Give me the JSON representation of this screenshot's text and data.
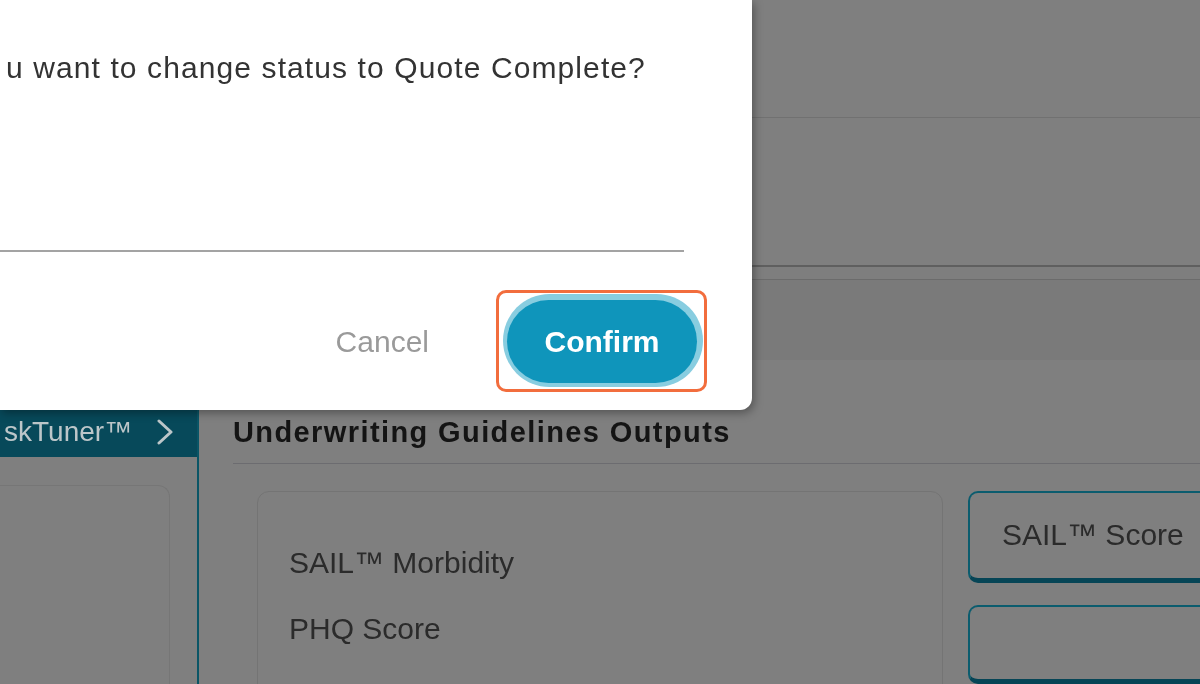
{
  "dialog": {
    "message": "u want to change status to Quote Complete?",
    "buttons": [
      {
        "kind": "text",
        "label": "Cancel",
        "focused": false,
        "highlighted": false
      },
      {
        "kind": "contained",
        "label": "Confirm",
        "focused": true,
        "highlighted": true
      }
    ]
  },
  "sidebar": {
    "header": "skTuner™"
  },
  "main": {
    "heading": "Underwriting Guidelines Outputs",
    "outputs": [
      "SAIL™ Morbidity",
      "PHQ Score"
    ],
    "score_cards": [
      {
        "label": "SAIL™ Score"
      }
    ]
  }
}
